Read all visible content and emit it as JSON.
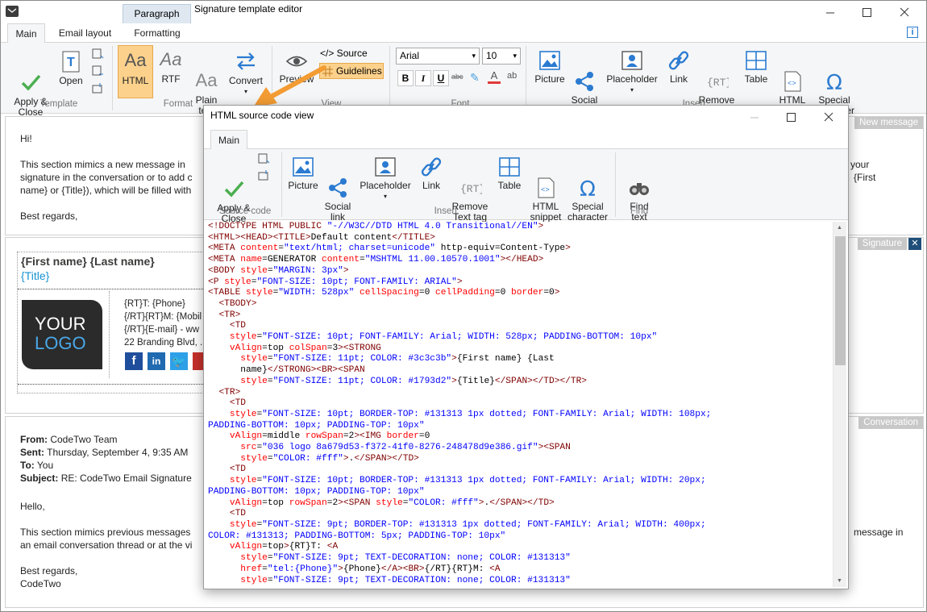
{
  "window": {
    "title": "Signature template editor",
    "context_tab": "Paragraph"
  },
  "ribbon_tabs": [
    "Main",
    "Email layout",
    "Formatting"
  ],
  "ribbon": {
    "template": {
      "label": "Template",
      "apply_close": "Apply &\nClose",
      "open": "Open"
    },
    "format": {
      "label": "Format",
      "html": "HTML",
      "rtf": "RTF",
      "plain_text": "Plain\ntext",
      "convert": "Convert"
    },
    "view": {
      "label": "View",
      "preview": "Preview",
      "source": "</> Source",
      "guidelines": "Guidelines"
    },
    "font": {
      "label": "Font",
      "family": "Arial",
      "size": "10"
    },
    "insert": {
      "label": "Insert",
      "picture": "Picture",
      "social_link": "Social\nlink",
      "placeholder": "Placeholder",
      "link": "Link",
      "remove_text_tag": "Remove\nText tag",
      "table": "Table",
      "html_snippet": "HTML\nsnippet",
      "special_character": "Special\ncharacter"
    }
  },
  "sections": {
    "new_message": {
      "tag": "New message",
      "greeting": "Hi!",
      "body_left": "This section mimics a new message in",
      "body_left2": "signature in the conversation or to add c",
      "body_left3": "name} or {Title}), which will be filled with",
      "body_right1": "your",
      "body_right2": "{First",
      "closing": "Best regards,"
    },
    "signature": {
      "tag": "Signature",
      "name": "{First name} {Last name}",
      "title": "{Title}",
      "logo_line1": "YOUR",
      "logo_line2": "LOGO",
      "phone": "{RT}T: {Phone}",
      "mobile": "{/RT}{RT}M: {Mobil",
      "email": "{/RT}{E-mail} - ww",
      "address": "22 Branding Blvd, ."
    },
    "conversation": {
      "tag": "Conversation",
      "from_label": "From:",
      "from": "CodeTwo Team",
      "sent_label": "Sent:",
      "sent": "Thursday, September 4, 9:35 AM",
      "to_label": "To:",
      "to": "You",
      "subject_label": "Subject:",
      "subject": "RE: CodeTwo Email Signature",
      "hello": "Hello,",
      "body1": "This section mimics previous messages",
      "body1_right": "message in",
      "body2": "an email conversation thread or at the vi",
      "regards": "Best regards,",
      "sign": "CodeTwo"
    }
  },
  "dialog": {
    "title": "HTML source code view",
    "tab": "Main",
    "source_code": {
      "label": "Source code",
      "apply_close": "Apply &\nClose"
    },
    "insert": {
      "label": "Insert",
      "picture": "Picture",
      "social_link": "Social\nlink",
      "placeholder": "Placeholder",
      "link": "Link",
      "remove_text_tag": "Remove\nText tag",
      "table": "Table",
      "html_snippet": "HTML\nsnippet",
      "special_character": "Special\ncharacter"
    },
    "find": {
      "label": "Find",
      "find_text": "Find\ntext"
    },
    "code_lines": [
      [
        [
          "t",
          "<!DOCTYPE HTML PUBLIC "
        ],
        [
          "v",
          "\"-//W3C//DTD HTML 4.0 Transitional//EN\""
        ],
        [
          "t",
          ">"
        ]
      ],
      [
        [
          "t",
          "<HTML><HEAD><TITLE>"
        ],
        [
          "x",
          "Default content"
        ],
        [
          "t",
          "</TITLE>"
        ]
      ],
      [
        [
          "t",
          "<META "
        ],
        [
          "a",
          "content"
        ],
        [
          "x",
          "="
        ],
        [
          "v",
          "\"text/html; charset=unicode\""
        ],
        [
          "x",
          " http-equiv=Content-Type"
        ],
        [
          "t",
          ">"
        ]
      ],
      [
        [
          "t",
          "<META "
        ],
        [
          "a",
          "name"
        ],
        [
          "x",
          "=GENERATOR "
        ],
        [
          "a",
          "content"
        ],
        [
          "x",
          "="
        ],
        [
          "v",
          "\"MSHTML 11.00.10570.1001\""
        ],
        [
          "t",
          "></HEAD>"
        ]
      ],
      [
        [
          "t",
          "<BODY "
        ],
        [
          "a",
          "style"
        ],
        [
          "x",
          "="
        ],
        [
          "v",
          "\"MARGIN: 3px\""
        ],
        [
          "t",
          ">"
        ]
      ],
      [
        [
          "t",
          "<P "
        ],
        [
          "a",
          "style"
        ],
        [
          "x",
          "="
        ],
        [
          "v",
          "\"FONT-SIZE: 10pt; FONT-FAMILY: ARIAL\""
        ],
        [
          "t",
          ">"
        ]
      ],
      [
        [
          "t",
          "<TABLE "
        ],
        [
          "a",
          "style"
        ],
        [
          "x",
          "="
        ],
        [
          "v",
          "\"WIDTH: 528px\""
        ],
        [
          "x",
          " "
        ],
        [
          "a",
          "cellSpacing"
        ],
        [
          "x",
          "=0 "
        ],
        [
          "a",
          "cellPadding"
        ],
        [
          "x",
          "=0 "
        ],
        [
          "a",
          "border"
        ],
        [
          "x",
          "=0"
        ],
        [
          "t",
          ">"
        ]
      ],
      [
        [
          "x",
          "  "
        ],
        [
          "t",
          "<TBODY>"
        ]
      ],
      [
        [
          "x",
          "  "
        ],
        [
          "t",
          "<TR>"
        ]
      ],
      [
        [
          "x",
          "    "
        ],
        [
          "t",
          "<TD"
        ]
      ],
      [
        [
          "x",
          "    "
        ],
        [
          "a",
          "style"
        ],
        [
          "x",
          "="
        ],
        [
          "v",
          "\"FONT-SIZE: 10pt; FONT-FAMILY: Arial; WIDTH: 528px; PADDING-BOTTOM: 10px\""
        ]
      ],
      [
        [
          "x",
          "    "
        ],
        [
          "a",
          "vAlign"
        ],
        [
          "x",
          "=top "
        ],
        [
          "a",
          "colSpan"
        ],
        [
          "x",
          "=3"
        ],
        [
          "t",
          "><STRONG"
        ]
      ],
      [
        [
          "x",
          "      "
        ],
        [
          "a",
          "style"
        ],
        [
          "x",
          "="
        ],
        [
          "v",
          "\"FONT-SIZE: 11pt; COLOR: #3c3c3b\""
        ],
        [
          "t",
          ">"
        ],
        [
          "x",
          "{First name} {Last"
        ]
      ],
      [
        [
          "x",
          "      name}"
        ],
        [
          "t",
          "</STRONG><BR><SPAN"
        ]
      ],
      [
        [
          "x",
          "      "
        ],
        [
          "a",
          "style"
        ],
        [
          "x",
          "="
        ],
        [
          "v",
          "\"FONT-SIZE: 11pt; COLOR: #1793d2\""
        ],
        [
          "t",
          ">"
        ],
        [
          "x",
          "{Title}"
        ],
        [
          "t",
          "</SPAN></TD></TR>"
        ]
      ],
      [
        [
          "x",
          "  "
        ],
        [
          "t",
          "<TR>"
        ]
      ],
      [
        [
          "x",
          "    "
        ],
        [
          "t",
          "<TD"
        ]
      ],
      [
        [
          "x",
          "    "
        ],
        [
          "a",
          "style"
        ],
        [
          "x",
          "="
        ],
        [
          "v",
          "\"FONT-SIZE: 10pt; BORDER-TOP: #131313 1px dotted; FONT-FAMILY: Arial; WIDTH: 108px;"
        ]
      ],
      [
        [
          "v",
          "PADDING-BOTTOM: 10px; PADDING-TOP: 10px\""
        ]
      ],
      [
        [
          "x",
          "    "
        ],
        [
          "a",
          "vAlign"
        ],
        [
          "x",
          "=middle "
        ],
        [
          "a",
          "rowSpan"
        ],
        [
          "x",
          "=2"
        ],
        [
          "t",
          "><IMG "
        ],
        [
          "a",
          "border"
        ],
        [
          "x",
          "=0"
        ]
      ],
      [
        [
          "x",
          "      "
        ],
        [
          "a",
          "src"
        ],
        [
          "x",
          "="
        ],
        [
          "v",
          "\"036 logo 8a679d53-f372-41f0-8276-248478d9e386.gif\""
        ],
        [
          "t",
          "><SPAN"
        ]
      ],
      [
        [
          "x",
          "      "
        ],
        [
          "a",
          "style"
        ],
        [
          "x",
          "="
        ],
        [
          "v",
          "\"COLOR: #fff\""
        ],
        [
          "t",
          ">"
        ],
        [
          "x",
          "."
        ],
        [
          "t",
          "</SPAN></TD>"
        ]
      ],
      [
        [
          "x",
          "    "
        ],
        [
          "t",
          "<TD"
        ]
      ],
      [
        [
          "x",
          "    "
        ],
        [
          "a",
          "style"
        ],
        [
          "x",
          "="
        ],
        [
          "v",
          "\"FONT-SIZE: 10pt; BORDER-TOP: #131313 1px dotted; FONT-FAMILY: Arial; WIDTH: 20px;"
        ]
      ],
      [
        [
          "v",
          "PADDING-BOTTOM: 10px; PADDING-TOP: 10px\""
        ]
      ],
      [
        [
          "x",
          "    "
        ],
        [
          "a",
          "vAlign"
        ],
        [
          "x",
          "=top "
        ],
        [
          "a",
          "rowSpan"
        ],
        [
          "x",
          "=2"
        ],
        [
          "t",
          "><SPAN "
        ],
        [
          "a",
          "style"
        ],
        [
          "x",
          "="
        ],
        [
          "v",
          "\"COLOR: #fff\""
        ],
        [
          "t",
          ">"
        ],
        [
          "x",
          "."
        ],
        [
          "t",
          "</SPAN></TD>"
        ]
      ],
      [
        [
          "x",
          "    "
        ],
        [
          "t",
          "<TD"
        ]
      ],
      [
        [
          "x",
          "    "
        ],
        [
          "a",
          "style"
        ],
        [
          "x",
          "="
        ],
        [
          "v",
          "\"FONT-SIZE: 9pt; BORDER-TOP: #131313 1px dotted; FONT-FAMILY: Arial; WIDTH: 400px;"
        ]
      ],
      [
        [
          "v",
          "COLOR: #131313; PADDING-BOTTOM: 5px; PADDING-TOP: 10px\""
        ]
      ],
      [
        [
          "x",
          "    "
        ],
        [
          "a",
          "vAlign"
        ],
        [
          "x",
          "=top"
        ],
        [
          "t",
          ">"
        ],
        [
          "x",
          "{RT}T: "
        ],
        [
          "t",
          "<A"
        ]
      ],
      [
        [
          "x",
          "      "
        ],
        [
          "a",
          "style"
        ],
        [
          "x",
          "="
        ],
        [
          "v",
          "\"FONT-SIZE: 9pt; TEXT-DECORATION: none; COLOR: #131313\""
        ]
      ],
      [
        [
          "x",
          "      "
        ],
        [
          "a",
          "href"
        ],
        [
          "x",
          "="
        ],
        [
          "v",
          "\"tel:{Phone}\""
        ],
        [
          "t",
          ">"
        ],
        [
          "x",
          "{Phone}"
        ],
        [
          "t",
          "</A><BR>"
        ],
        [
          "x",
          "{/RT}{RT}M: "
        ],
        [
          "t",
          "<A"
        ]
      ],
      [
        [
          "x",
          "      "
        ],
        [
          "a",
          "style"
        ],
        [
          "x",
          "="
        ],
        [
          "v",
          "\"FONT-SIZE: 9pt; TEXT-DECORATION: none; COLOR: #131313\""
        ]
      ]
    ]
  },
  "colors": {
    "accent": "#2b7bd1",
    "green": "#4caf50",
    "arrow": "#f39c33",
    "selected": "#fcd18c"
  }
}
